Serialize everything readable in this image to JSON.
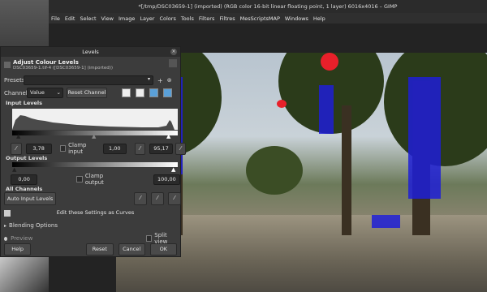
{
  "window_title": "*[/tmp/DSC03659-1] (imported) (RGB color 16-bit linear floating point, 1 layer) 6016x4016 – GIMP",
  "menu": [
    "File",
    "Edit",
    "Select",
    "View",
    "Image",
    "Layer",
    "Colors",
    "Tools",
    "Filters",
    "Filtres",
    "MesScriptsMAP",
    "Windows",
    "Help"
  ],
  "dialog": {
    "title": "Levels",
    "heading": "Adjust Colour Levels",
    "subheading": "DSC03659-1.tif-4 ([DSC03659-1] (imported))",
    "presets_label": "Presets:",
    "channel_label": "Channel:",
    "channel_value": "Value",
    "reset_channel": "Reset Channel",
    "input_levels": "Input Levels",
    "input_low": "3,78",
    "clamp_input": "Clamp input",
    "input_gamma": "1,00",
    "input_high": "95,17",
    "output_levels": "Output Levels",
    "output_low": "0,00",
    "clamp_output": "Clamp output",
    "output_high": "100,00",
    "all_channels": "All Channels",
    "auto_input": "Auto Input Levels",
    "edit_curves": "Edit these Settings as Curves",
    "blending_options": "Blending Options",
    "preview": "Preview",
    "split_view": "Split view",
    "help": "Help",
    "reset": "Reset",
    "cancel": "Cancel",
    "ok": "OK"
  }
}
